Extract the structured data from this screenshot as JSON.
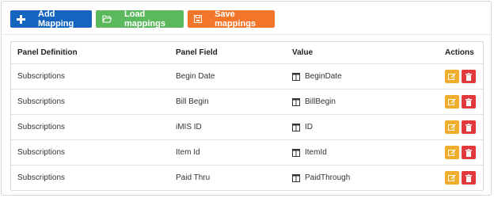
{
  "toolbar": {
    "add_label": "Add Mapping",
    "load_label": "Load mappings",
    "save_label": "Save mappings",
    "add_icon": "plus-icon",
    "load_icon": "folder-open-icon",
    "save_icon": "floppy-disk-icon"
  },
  "table": {
    "columns": [
      "Panel Definition",
      "Panel Field",
      "Value",
      "Actions"
    ],
    "rows": [
      {
        "panel_definition": "Subscriptions",
        "panel_field": "Begin Date",
        "value": "BeginDate"
      },
      {
        "panel_definition": "Subscriptions",
        "panel_field": "Bill Begin",
        "value": "BillBegin"
      },
      {
        "panel_definition": "Subscriptions",
        "panel_field": "iMIS ID",
        "value": "ID"
      },
      {
        "panel_definition": "Subscriptions",
        "panel_field": "Item Id",
        "value": "ItemId"
      },
      {
        "panel_definition": "Subscriptions",
        "panel_field": "Paid Thru",
        "value": "PaidThrough"
      }
    ],
    "value_icon": "table-column-icon",
    "edit_icon": "edit-icon",
    "delete_icon": "trash-icon"
  },
  "colors": {
    "add": "#1565c0",
    "load": "#5cb85c",
    "save": "#f4762a",
    "edit": "#f0ad2b",
    "delete": "#e03939"
  }
}
